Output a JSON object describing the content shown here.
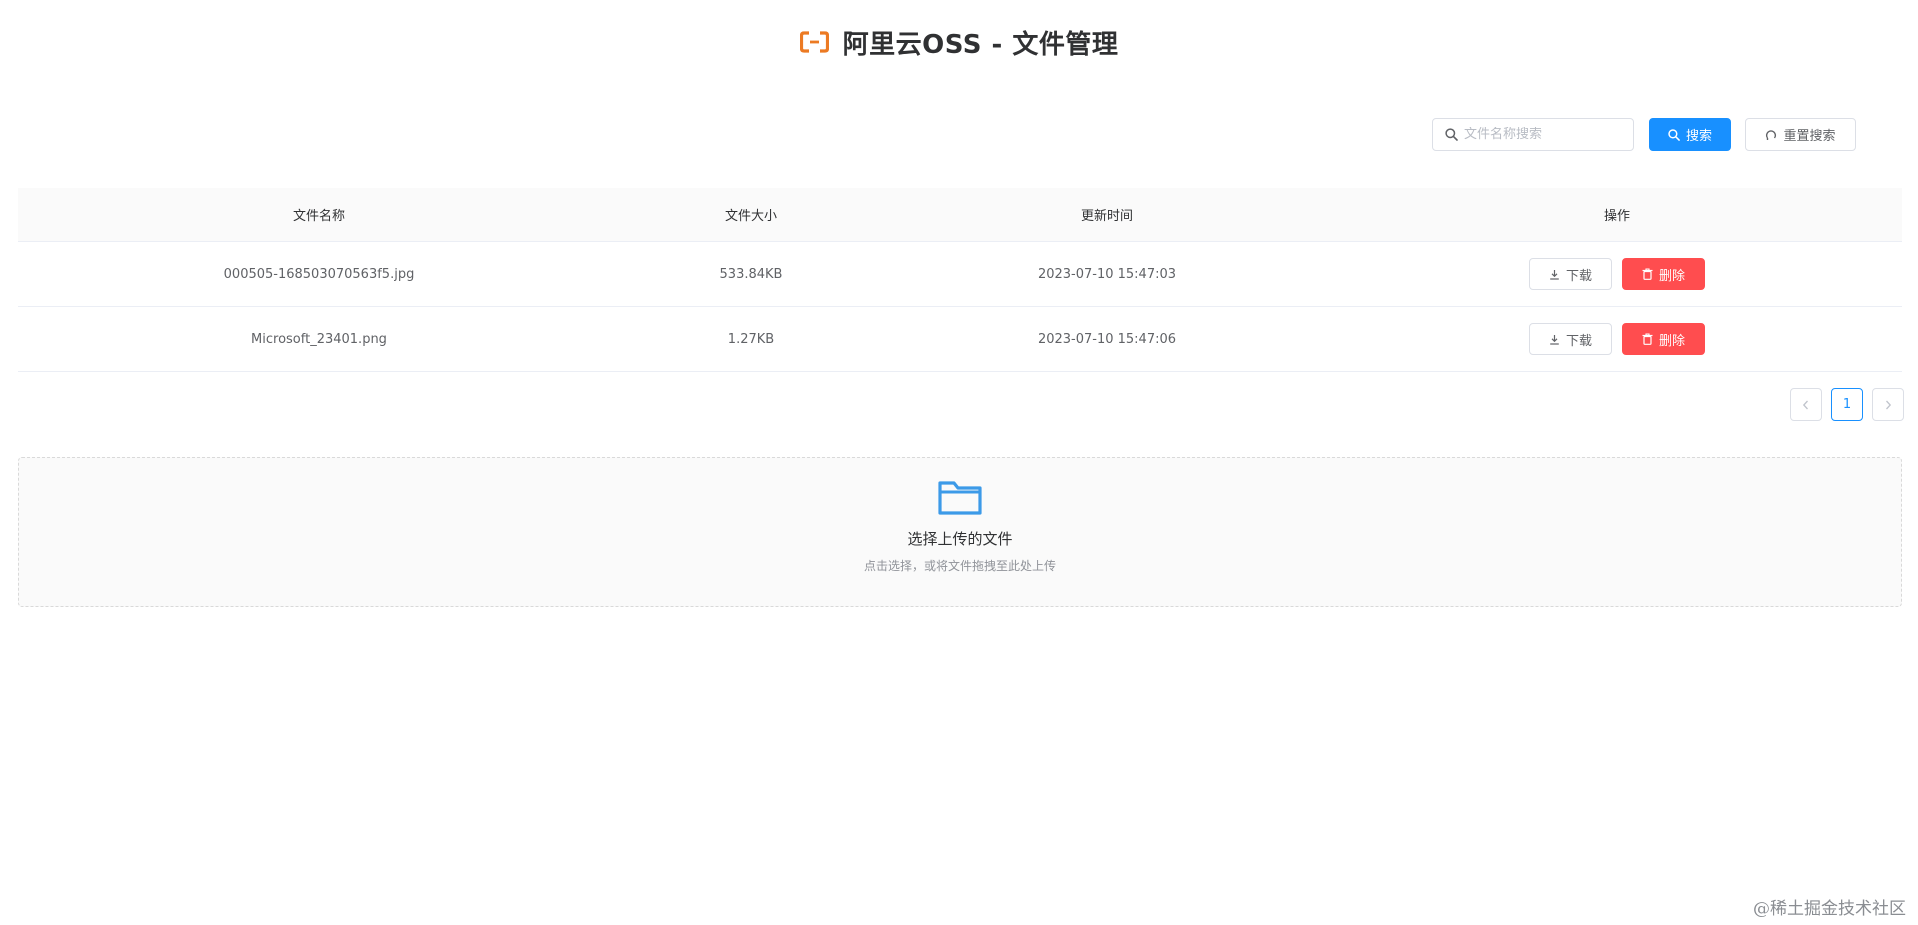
{
  "header": {
    "title": "阿里云OSS - 文件管理",
    "logo_icon": "aliyun-logo-icon",
    "brand_color": "#ec7a23"
  },
  "toolbar": {
    "search_placeholder": "文件名称搜索",
    "search_value": "",
    "search_label": "搜索",
    "reset_label": "重置搜索"
  },
  "table": {
    "columns": [
      "文件名称",
      "文件大小",
      "更新时间",
      "操作"
    ],
    "rows": [
      {
        "name": "000505-168503070563f5.jpg",
        "size": "533.84KB",
        "updated": "2023-07-10 15:47:03"
      },
      {
        "name": "Microsoft_23401.png",
        "size": "1.27KB",
        "updated": "2023-07-10 15:47:06"
      }
    ],
    "download_label": "下载",
    "delete_label": "删除"
  },
  "pagination": {
    "current_page": "1",
    "prev_icon": "chevron-left-icon",
    "next_icon": "chevron-right-icon"
  },
  "upload": {
    "title": "选择上传的文件",
    "hint": "点击选择，或将文件拖拽至此处上传",
    "icon": "folder-icon"
  },
  "watermark": "@稀土掘金技术社区",
  "colors": {
    "primary": "#1890ff",
    "danger": "#ff4d4f",
    "border": "#dcdfe6"
  }
}
